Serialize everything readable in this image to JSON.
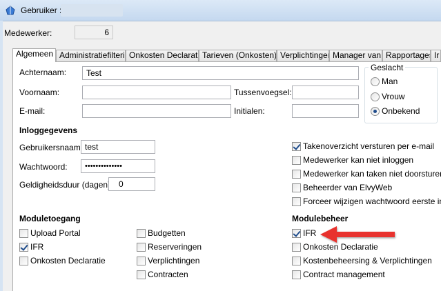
{
  "window": {
    "title": "Gebruiker :"
  },
  "employee": {
    "label": "Medewerker:",
    "value": "6"
  },
  "tabs": [
    "Algemeen",
    "Administratiefiltering",
    "Onkosten Declaratie",
    "Tarieven (Onkosten)",
    "Verplichtingen",
    "Manager van",
    "Rapportages",
    "Ir"
  ],
  "general": {
    "achternaam": {
      "label": "Achternaam:",
      "value": "Test"
    },
    "voornaam": {
      "label": "Voornaam:",
      "value": ""
    },
    "tussenvoegsel": {
      "label": "Tussenvoegsel:",
      "value": ""
    },
    "email": {
      "label": "E-mail:",
      "value": ""
    },
    "initialen": {
      "label": "Initialen:",
      "value": ""
    }
  },
  "gender": {
    "title": "Geslacht",
    "options": [
      "Man",
      "Vrouw",
      "Onbekend"
    ],
    "selected": "Onbekend"
  },
  "login": {
    "title": "Inloggegevens",
    "username": {
      "label": "Gebruikersnaam:",
      "value": "test"
    },
    "password": {
      "label": "Wachtwoord:",
      "value": "••••••••••••••"
    },
    "validity": {
      "label": "Geldigheidsduur (dagen):",
      "value": "0"
    }
  },
  "options": [
    {
      "label": "Takenoverzicht versturen per e-mail",
      "checked": true
    },
    {
      "label": "Medewerker kan niet inloggen",
      "checked": false
    },
    {
      "label": "Medewerker kan taken niet doorsturen",
      "checked": false
    },
    {
      "label": "Beheerder van ElvyWeb",
      "checked": false
    },
    {
      "label": "Forceer wijzigen wachtwoord eerste inlog",
      "checked": false
    }
  ],
  "module_access": {
    "title": "Moduletoegang",
    "col1": [
      {
        "label": "Upload Portal",
        "checked": false
      },
      {
        "label": "IFR",
        "checked": true
      },
      {
        "label": "Onkosten Declaratie",
        "checked": false
      }
    ],
    "col2": [
      {
        "label": "Budgetten",
        "checked": false
      },
      {
        "label": "Reserveringen",
        "checked": false
      },
      {
        "label": "Verplichtingen",
        "checked": false
      },
      {
        "label": "Contracten",
        "checked": false
      }
    ]
  },
  "module_management": {
    "title": "Modulebeheer",
    "items": [
      {
        "label": "IFR",
        "checked": true
      },
      {
        "label": "Onkosten Declaratie",
        "checked": false
      },
      {
        "label": "Kostenbeheersing & Verplichtingen",
        "checked": false
      },
      {
        "label": "Contract management",
        "checked": false
      }
    ]
  },
  "colors": {
    "arrow": "#e8312f",
    "title_bar": "#c4d8ef",
    "checkmark": "#1f4c8b"
  }
}
